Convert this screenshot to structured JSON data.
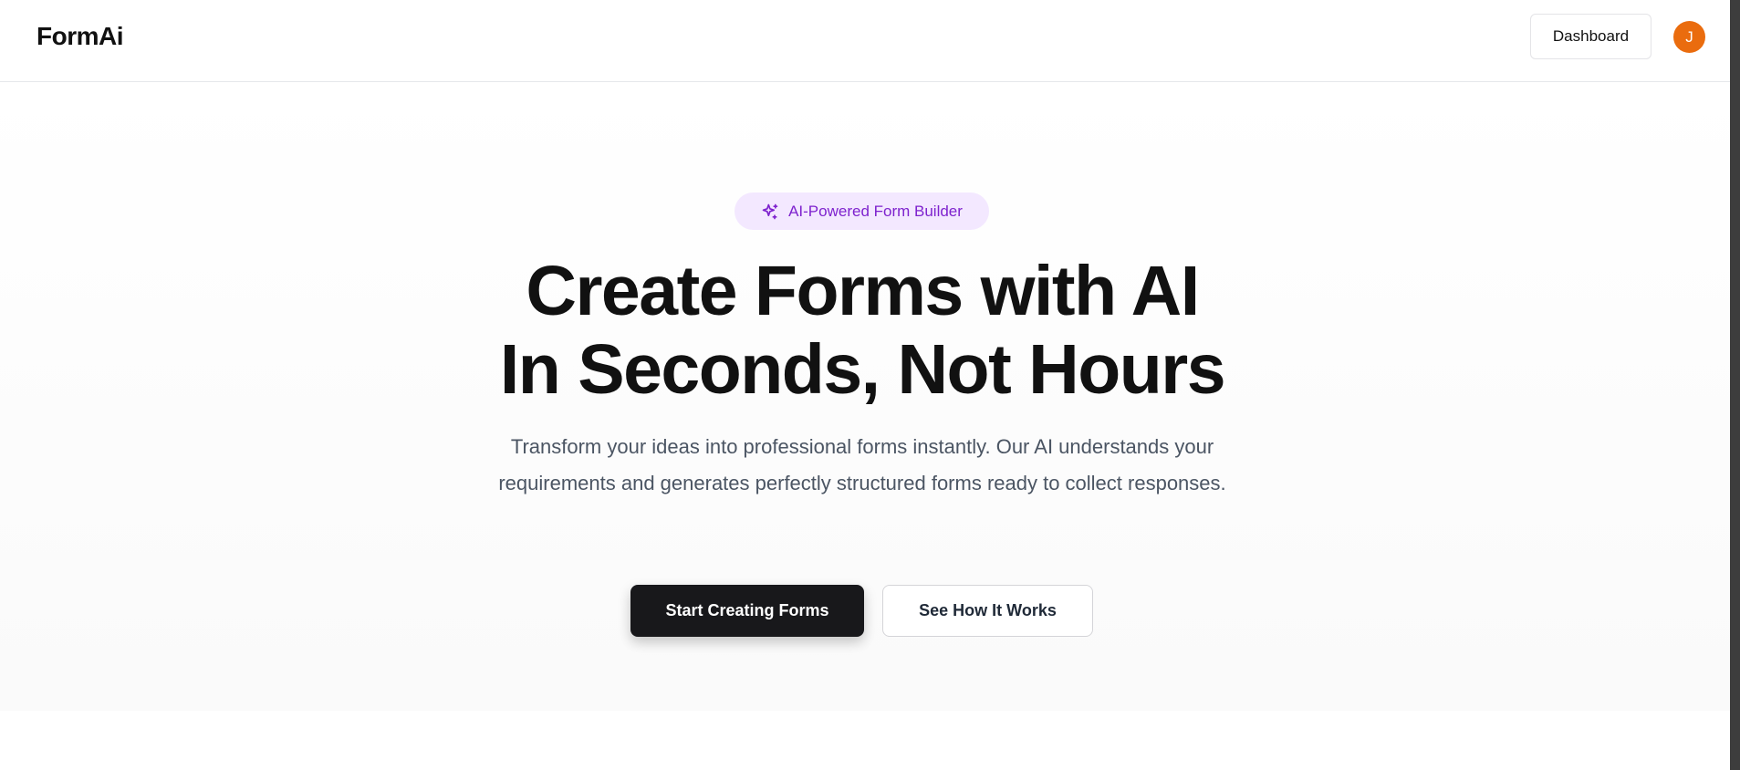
{
  "header": {
    "logo": "FormAi",
    "dashboard_label": "Dashboard",
    "avatar_initial": "J"
  },
  "hero": {
    "badge_icon": "sparkles-icon",
    "badge_label": "AI-Powered Form Builder",
    "headline_line1": "Create Forms with AI",
    "headline_line2": "In Seconds, Not Hours",
    "subtitle": "Transform your ideas into professional forms instantly. Our AI understands your requirements and generates perfectly structured forms ready to collect responses.",
    "primary_cta": "Start Creating Forms",
    "secondary_cta": "See How It Works"
  },
  "colors": {
    "accent_purple": "#7e22ce",
    "badge_bg": "#f3e8ff",
    "avatar_orange": "#ea6c0e",
    "primary_button": "#18181b"
  }
}
